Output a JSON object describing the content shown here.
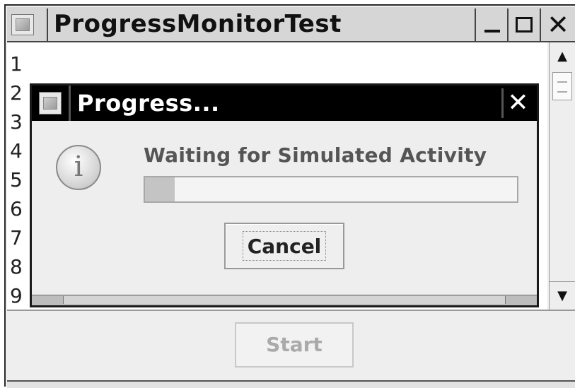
{
  "window": {
    "title": "ProgressMonitorTest",
    "minimize_icon": "minimize-icon",
    "maximize_icon": "maximize-icon",
    "close_glyph": "✕"
  },
  "textarea": {
    "lines": [
      "1",
      "2",
      "3",
      "4",
      "5",
      "6",
      "7",
      "8",
      "9"
    ]
  },
  "scrollbar": {
    "up_glyph": "▲",
    "down_glyph": "▼"
  },
  "dialog": {
    "title": "Progress...",
    "close_glyph": "✕",
    "info_glyph": "i",
    "message": "Waiting for Simulated Activity",
    "progress": 0.08,
    "cancel_label": "Cancel"
  },
  "bottom": {
    "start_label": "Start",
    "start_enabled": false
  },
  "colors": {
    "dialog_titlebar": "#000000",
    "progress_fill": "#c4c4c4",
    "disabled_text": "#aaaaaa"
  }
}
